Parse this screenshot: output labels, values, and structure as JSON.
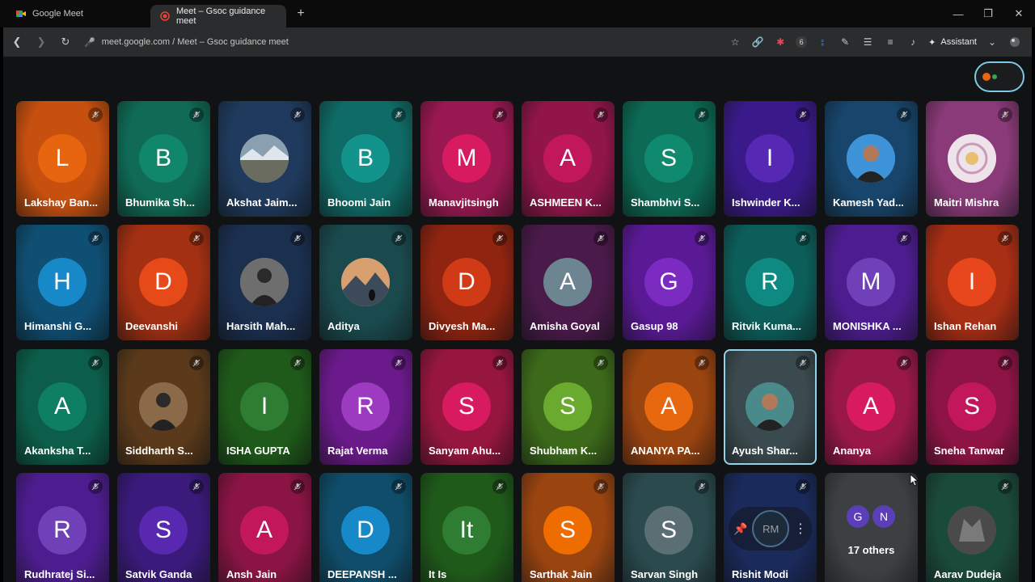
{
  "browser": {
    "tabs": [
      {
        "label": "Google Meet",
        "icon": "google-meet-icon"
      },
      {
        "label": "Meet – Gsoc guidance meet",
        "icon": "recording-icon",
        "active": true
      }
    ],
    "url": "meet.google.com / Meet – Gsoc guidance meet",
    "extension_badge": "6",
    "assistant_label": "Assistant"
  },
  "meeting": {
    "participants": [
      {
        "name": "Lakshay Ban...",
        "initial": "L",
        "bg": "#c7500f",
        "av": "#e8650f"
      },
      {
        "name": "Bhumika Sh...",
        "initial": "B",
        "bg": "#0f6b56",
        "av": "#10876a"
      },
      {
        "name": "Akshat Jaim...",
        "initial": "",
        "bg": "#1f3a5c",
        "av": "#6f8596",
        "photo": "landscape"
      },
      {
        "name": "Bhoomi Jain",
        "initial": "B",
        "bg": "#0f6b66",
        "av": "#12938c"
      },
      {
        "name": "Manavjitsingh",
        "initial": "M",
        "bg": "#9a1851",
        "av": "#d81b60"
      },
      {
        "name": "ASHMEEN K...",
        "initial": "A",
        "bg": "#92154a",
        "av": "#c2185b"
      },
      {
        "name": "Shambhvi S...",
        "initial": "S",
        "bg": "#0c6a55",
        "av": "#0f8a6e"
      },
      {
        "name": "Ishwinder K...",
        "initial": "I",
        "bg": "#3a1a8a",
        "av": "#5728b4"
      },
      {
        "name": "Kamesh Yad...",
        "initial": "",
        "bg": "#17456b",
        "av": "#3f93d8",
        "photo": "person"
      },
      {
        "name": "Maitri Mishra",
        "initial": "",
        "bg": "#8a3a78",
        "av": "#e6d7e2",
        "photo": "mandala"
      },
      {
        "name": "Himanshi G...",
        "initial": "H",
        "bg": "#0f4f73",
        "av": "#1889c8"
      },
      {
        "name": "Deevanshi",
        "initial": "D",
        "bg": "#a33012",
        "av": "#e64a19"
      },
      {
        "name": "Harsith Mah...",
        "initial": "",
        "bg": "#1b2f4f",
        "av": "#6e6e6e",
        "photo": "person-dark"
      },
      {
        "name": "Aditya",
        "initial": "",
        "bg": "#1a4a4d",
        "av": "#d58a5a",
        "photo": "mountain"
      },
      {
        "name": "Divyesh Ma...",
        "initial": "D",
        "bg": "#8f2410",
        "av": "#d03a16"
      },
      {
        "name": "Amisha Goyal",
        "initial": "A",
        "bg": "#4a1a4a",
        "av": "#6d8590"
      },
      {
        "name": "Gasup 98",
        "initial": "G",
        "bg": "#5a1a96",
        "av": "#7b2bc0"
      },
      {
        "name": "Ritvik Kuma...",
        "initial": "R",
        "bg": "#0c5e5a",
        "av": "#0f8a82"
      },
      {
        "name": "MONISHKA ...",
        "initial": "M",
        "bg": "#4d1d8f",
        "av": "#7040b8"
      },
      {
        "name": "Ishan Rehan",
        "initial": "I",
        "bg": "#a82e14",
        "av": "#e8461c"
      },
      {
        "name": "Akanksha T...",
        "initial": "A",
        "bg": "#0c5e4a",
        "av": "#0f7f63"
      },
      {
        "name": "Siddharth S...",
        "initial": "",
        "bg": "#5a3a1a",
        "av": "#8b6a4a",
        "photo": "person-dark"
      },
      {
        "name": "ISHA GUPTA",
        "initial": "I",
        "bg": "#1f5a1a",
        "av": "#2e7d32"
      },
      {
        "name": "Rajat Verma",
        "initial": "R",
        "bg": "#6a1a8a",
        "av": "#9c3bbf"
      },
      {
        "name": "Sanyam Ahu...",
        "initial": "S",
        "bg": "#96163f",
        "av": "#d81b60"
      },
      {
        "name": "Shubham K...",
        "initial": "S",
        "bg": "#3d6a1a",
        "av": "#6aaa2e"
      },
      {
        "name": "ANANYA PA...",
        "initial": "A",
        "bg": "#9a4410",
        "av": "#e8680f"
      },
      {
        "name": "Ayush Shar...",
        "initial": "",
        "bg": "#3b4a4e",
        "av": "#4a8a8a",
        "photo": "person",
        "selected": true
      },
      {
        "name": "Ananya",
        "initial": "A",
        "bg": "#9a1848",
        "av": "#d81b60"
      },
      {
        "name": "Sneha Tanwar",
        "initial": "S",
        "bg": "#8f1446",
        "av": "#c2185b"
      },
      {
        "name": "Rudhratej Si...",
        "initial": "R",
        "bg": "#4d1d8f",
        "av": "#7040b8"
      },
      {
        "name": "Satvik Ganda",
        "initial": "S",
        "bg": "#3a1a7a",
        "av": "#5828b0"
      },
      {
        "name": "Ansh Jain",
        "initial": "A",
        "bg": "#8a1444",
        "av": "#c2185b"
      },
      {
        "name": "DEEPANSH ...",
        "initial": "D",
        "bg": "#0f4d6a",
        "av": "#1889c8"
      },
      {
        "name": "It Is",
        "initial": "It",
        "bg": "#1f5a1a",
        "av": "#2e7d32"
      },
      {
        "name": "Sarthak Jain",
        "initial": "S",
        "bg": "#9a4410",
        "av": "#ef6c00"
      },
      {
        "name": "Sarvan Singh",
        "initial": "S",
        "bg": "#2b4a4e",
        "av": "#5b6e74"
      },
      {
        "name": "Rishit Modi",
        "initial": "RM",
        "bg": "#1a2a5a",
        "av": "#1c2a3a",
        "hover": true
      },
      {
        "name": "17 others",
        "initial": "",
        "bg": "#3c4043",
        "av": "",
        "others": [
          "G",
          "N"
        ]
      },
      {
        "name": "Aarav Dudeja",
        "initial": "",
        "bg": "#1a4a3a",
        "av": "#5a5a5a",
        "photo": "wolf"
      }
    ]
  }
}
